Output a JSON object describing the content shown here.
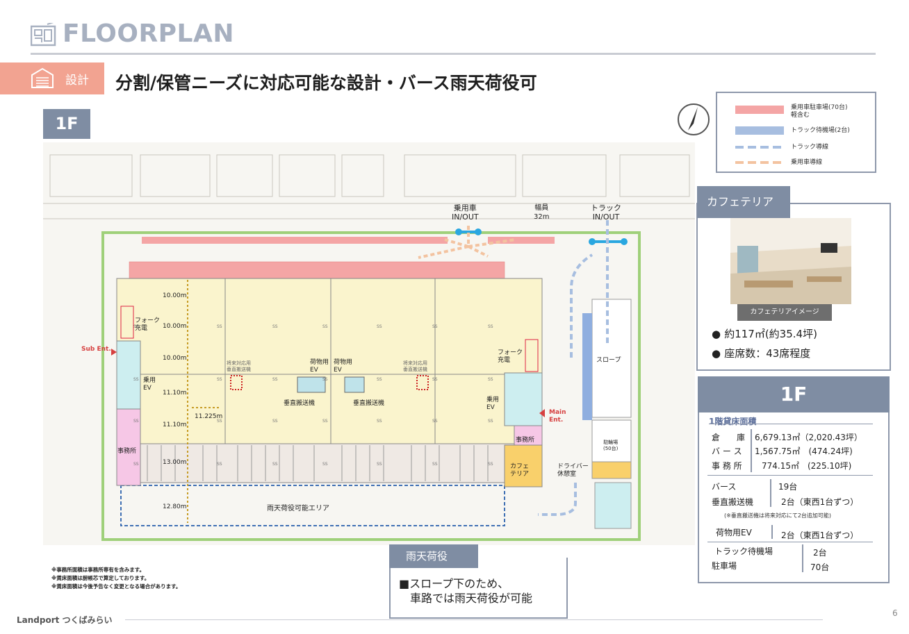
{
  "header": {
    "title": "FLOORPLAN"
  },
  "design_badge": {
    "label": "設計"
  },
  "subtitle": "分割/保管ニーズに対応可能な設計・バース雨天荷役可",
  "floor_badge": "1F",
  "compass": {
    "north": "N"
  },
  "legend": {
    "items": [
      {
        "line1": "乗用車駐車場(70台)",
        "line2": "軽含む",
        "color": "#f4a5a5",
        "style": "solid"
      },
      {
        "line1": "トラック待機場(2台)",
        "line2": "",
        "color": "#a7bee0",
        "style": "solid"
      },
      {
        "line1": "トラック導線",
        "line2": "",
        "color": "#a7bee0",
        "style": "dashed"
      },
      {
        "line1": "乗用車導線",
        "line2": "",
        "color": "#f3c3a0",
        "style": "dashed"
      }
    ]
  },
  "plan": {
    "entrance_car": "乗用車\nIN/OUT",
    "frontage": "幅員\n32m",
    "entrance_truck": "トラック\nIN/OUT",
    "sub_ent": "Sub Ent.",
    "main_ent": "Main\nEnt.",
    "fork_charge_left": "フォーク\n充電",
    "fork_charge_right": "フォーク\n充電",
    "ev_left": "乗用\nEV",
    "ev_right": "乗用\nEV",
    "cargo_ev_left": "荷物用\nEV",
    "cargo_ev_right": "荷物用\nEV",
    "future_lift_left": "将来対応用\n垂直搬送機",
    "future_lift_right": "将来対応用\n垂直搬送機",
    "vertical_lift_left": "垂直搬送機",
    "vertical_lift_right": "垂直搬送機",
    "office_left": "事務所",
    "office_right": "事務所",
    "cafeteria": "カフェ\nテリア",
    "driver_rest": "ドライバー\n休憩室",
    "slope": "スロープ",
    "bike_parking": "駐輪場\n(50台)",
    "rain_area": "雨天荷役可能エリア",
    "dims": [
      "10.00m",
      "10.00m",
      "10.00m",
      "11.10m",
      "11.10m",
      "13.00m",
      "12.80m",
      "11.225m"
    ],
    "ss": "SS"
  },
  "cafeteria": {
    "tag": "カフェテリア",
    "image_caption": "カフェテリアイメージ",
    "lines": [
      "約117㎡(約35.4坪)",
      "座席数：43席程度"
    ]
  },
  "spec": {
    "title": "1F",
    "subtitle": "1階貸床面積",
    "areas": [
      {
        "label": "倉　　庫",
        "value": "6,679.13㎡（2,020.43坪）"
      },
      {
        "label": "バ ー ス",
        "value": "1,567.75㎡　(474.24坪)"
      },
      {
        "label": "事 務 所",
        "value": "774.15㎡　(225.10坪)"
      }
    ],
    "rows": [
      {
        "label": "バース",
        "value": "19台"
      },
      {
        "label": "垂直搬送機",
        "value": "2台（東西1台ずつ）"
      }
    ],
    "note": "(※垂直搬送機は将来対応にて2台追加可能)",
    "rows2": [
      {
        "label": "荷物用EV",
        "value": "2台（東西1台ずつ）"
      },
      {
        "label": "トラック待機場",
        "value": "2台"
      },
      {
        "label": "駐車場",
        "value": "70台"
      }
    ]
  },
  "rain": {
    "tag": "雨天荷役",
    "line1": "■スロープ下のため、",
    "line2": "車路では雨天荷役が可能"
  },
  "notes": [
    "※事務所面積は事務所専有を含みます。",
    "※賃床面積は厨帳芯で算定しております。",
    "※賃床面積は今後予告なく変更となる場合があります。"
  ],
  "footer": {
    "brand": "Landport つくばみらい",
    "page": "6"
  }
}
